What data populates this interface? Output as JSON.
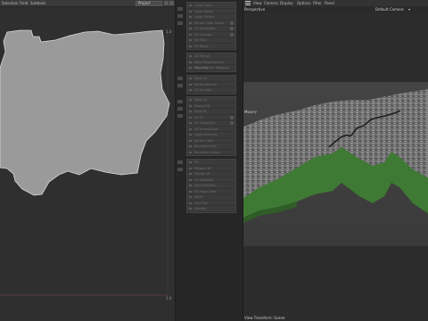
{
  "uv_editor": {
    "menu": [
      "Selection",
      "Field",
      "Subtools"
    ],
    "mode": "Project",
    "corners": {
      "top_right": "1.0",
      "bottom_right": "1.0"
    }
  },
  "layers": {
    "group1": [
      "Layer Color",
      "Layer Alpha",
      "Layer Vertex",
      "Vertex Color Adjust",
      "UV Subdivide",
      "UV Unwrap",
      "UV Pack",
      "UV Relax"
    ],
    "group2": [
      "UV Merge",
      "Bake Displacement Mapping",
      "Bake Texture Mapping"
    ],
    "group3": [
      "Mesh ID",
      "Vertex Normal",
      "UV Smooth"
    ],
    "group4": [
      "Mesh ID",
      "Normal ID",
      "Edge ID",
      "UV ID",
      "UV Transform",
      "UV Intersection",
      "Edge Selection",
      "Vertex Color",
      "Boundary Info",
      "Boundary Group"
    ],
    "group5": [
      "Fill",
      "Polygon ID",
      "Shader ID",
      "UV Attribute",
      "Sort Selection",
      "UV Edge Filter",
      "Bevel",
      "Grid Tile",
      "Display"
    ]
  },
  "viewport": {
    "menu": [
      "View",
      "Camera",
      "Display",
      "Options",
      "Filter",
      "Panel"
    ],
    "view_label": "Perspective",
    "camera_label": "Default Camera",
    "object_label": "Move",
    "status": "View Transform: Scene"
  },
  "colors": {
    "terrain_wall": "#3f7a34",
    "uv_shape": "#9a9a9a",
    "uv_outline": "#d8d8d8",
    "baseline": "#7a4a4a"
  }
}
